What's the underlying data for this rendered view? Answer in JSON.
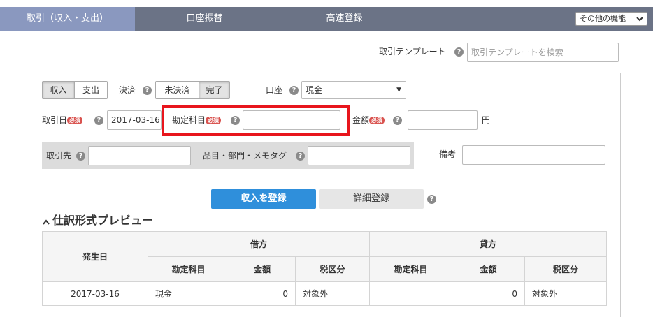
{
  "tabs": [
    {
      "label": "取引（収入・支出）",
      "active": true
    },
    {
      "label": "口座振替",
      "active": false
    },
    {
      "label": "高速登録",
      "active": false
    }
  ],
  "other_menu_label": "その他の機能",
  "template": {
    "label": "取引テンプレート",
    "placeholder": "取引テンプレートを検索"
  },
  "form": {
    "type_options": [
      "収入",
      "支出"
    ],
    "selected_type": "収入",
    "settlement_label": "決済",
    "settlement_options": [
      "未決済",
      "完了"
    ],
    "selected_settlement": "完了",
    "account_label": "口座",
    "account_value": "現金",
    "date_label": "取引日",
    "date_value": "2017-03-16",
    "required_badge": "必須",
    "account_item_label": "勘定科目",
    "account_item_value": "",
    "amount_label": "金額",
    "amount_value": "",
    "currency_unit": "円",
    "partner_label": "取引先",
    "partner_value": "",
    "item_tag_label": "品目・部門・メモタグ",
    "item_tag_value": "",
    "note_label": "備考",
    "note_value": ""
  },
  "buttons": {
    "register": "収入を登録",
    "detail": "詳細登録"
  },
  "preview": {
    "title": "仕訳形式プレビュー",
    "headers": {
      "date": "発生日",
      "debit": "借方",
      "credit": "貸方",
      "account": "勘定科目",
      "amount": "金額",
      "tax": "税区分"
    },
    "rows": [
      {
        "date": "2017-03-16",
        "debit_account": "現金",
        "debit_amount": "0",
        "debit_tax": "対象外",
        "credit_account": "",
        "credit_amount": "0",
        "credit_tax": "対象外"
      }
    ]
  },
  "colors": {
    "tabbar": "#6b7386",
    "active_tab": "#8a98bf",
    "primary_button": "#2f8fdb",
    "required_badge": "#d9534f",
    "highlight": "#e8151d"
  },
  "icons": {
    "help": "?",
    "chevron_down": "chevron-down-icon",
    "chevron_up": "chevron-up-icon",
    "select_arrow": "▼"
  }
}
